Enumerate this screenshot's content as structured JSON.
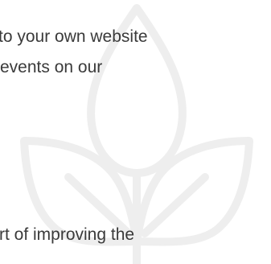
{
  "content": {
    "lines": [
      "to your own website",
      "events on our",
      "rt of improving the"
    ]
  },
  "theme": {
    "text_color": "#3a3a3a",
    "watermark_color": "#eeeeee",
    "background": "#ffffff"
  },
  "icons": {
    "watermark": "sprout-leaves-icon"
  }
}
